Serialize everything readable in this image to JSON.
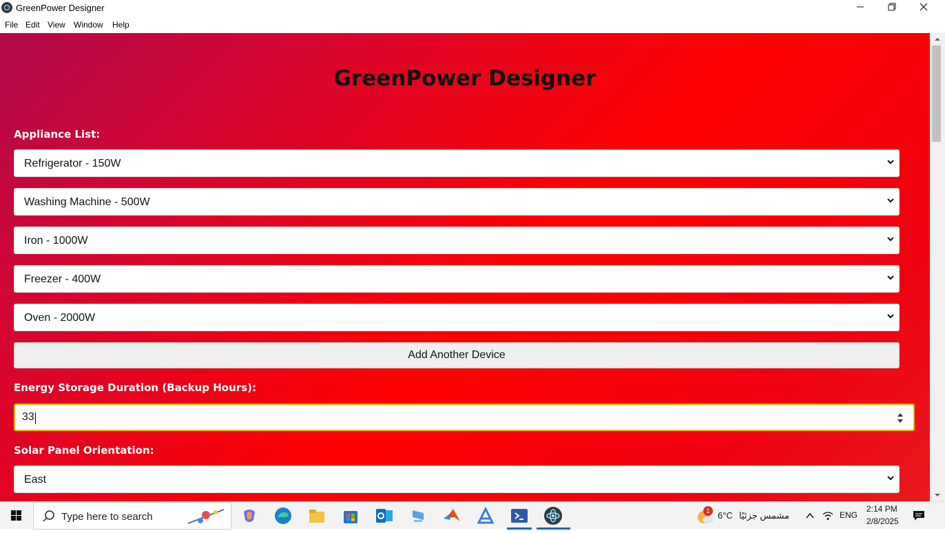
{
  "window": {
    "title": "GreenPower Designer"
  },
  "menu": [
    "File",
    "Edit",
    "View",
    "Window",
    "Help"
  ],
  "page": {
    "heading": "GreenPower Designer",
    "appliance_label": "Appliance List:",
    "appliances": [
      "Refrigerator - 150W",
      "Washing Machine - 500W",
      "Iron - 1000W",
      "Freezer - 400W",
      "Oven - 2000W"
    ],
    "add_button": "Add Another Device",
    "storage_label": "Energy Storage Duration (Backup Hours):",
    "storage_value": "33",
    "orientation_label": "Solar Panel Orientation:",
    "orientation_value": "East"
  },
  "taskbar": {
    "search_placeholder": "Type here to search",
    "weather_temp": "6°C",
    "weather_text": "مشمس جزئيًا",
    "weather_badge": "1",
    "language": "ENG",
    "time": "2:14 PM",
    "date": "2/8/2025"
  },
  "colors": {
    "gradient_start": "#b10a4c",
    "gradient_mid": "#ff0000",
    "input_focus_border": "#e7b800",
    "taskbar_active": "#0067c0"
  }
}
